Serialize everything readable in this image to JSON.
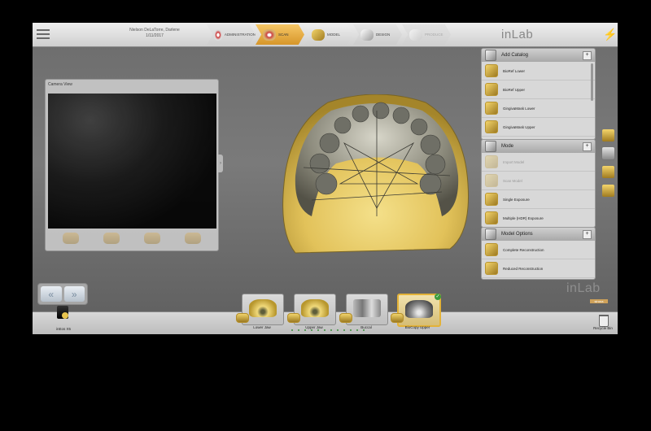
{
  "header": {
    "patient_name": "Nielson DeLaTorre, Darlene",
    "patient_date": "1/11/2017",
    "steps": [
      {
        "label": "Administration",
        "icon": "administration-icon"
      },
      {
        "label": "Scan",
        "icon": "scan-icon"
      },
      {
        "label": "Model",
        "icon": "model-icon"
      },
      {
        "label": "Design",
        "icon": "design-icon"
      },
      {
        "label": "Produce",
        "icon": "produce-icon"
      }
    ],
    "brand": "inLab"
  },
  "camera_view": {
    "title": "Camera View"
  },
  "panels": {
    "add_catalog": {
      "title": "Add Catalog",
      "items": [
        "BioRef Lower",
        "BioRef Upper",
        "GingivaMask Lower",
        "GingivaMask Upper"
      ]
    },
    "mode": {
      "title": "Mode",
      "items": [
        {
          "label": "Import Model",
          "enabled": false
        },
        {
          "label": "Scan Model",
          "enabled": false
        },
        {
          "label": "Single Exposure",
          "enabled": true
        },
        {
          "label": "Multiple (HDR) Exposure",
          "enabled": true
        }
      ]
    },
    "model_options": {
      "title": "Model Options",
      "items": [
        "Complete Reconstruction",
        "Reduced Reconstruction"
      ]
    }
  },
  "watermark": {
    "brand": "inLab",
    "sub": "sirona"
  },
  "bottom": {
    "device": "inEos X5",
    "recycle": "Recycle Bin",
    "catalogs": [
      "Lower Jaw",
      "Upper Jaw",
      "Buccal",
      "BioCopy Upper"
    ]
  },
  "colors": {
    "active_step": "#e0a438",
    "accent_gold": "#d9b24a",
    "check_green": "#3c9b3c"
  }
}
